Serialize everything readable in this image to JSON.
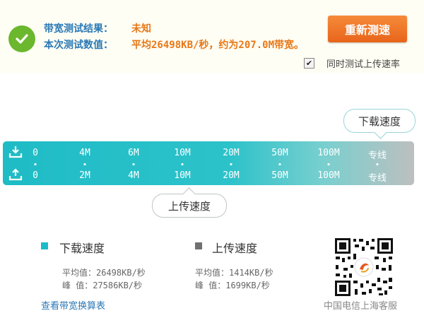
{
  "header": {
    "result_label": "带宽测试结果：",
    "result_value": "未知",
    "value_label": "本次测试数值：",
    "value_text": "平均26498KB/秒，约为207.0M带宽。",
    "retest_label": "重新测速",
    "upload_checkbox_checked": true,
    "upload_checkbox_label": "同时测试上传速率"
  },
  "callouts": {
    "download": "下载速度",
    "upload": "上传速度"
  },
  "speed_bar": {
    "download_ticks": [
      "0",
      "4M",
      "6M",
      "10M",
      "20M",
      "50M",
      "100M",
      "专线"
    ],
    "upload_ticks": [
      "0",
      "2M",
      "4M",
      "10M",
      "20M",
      "50M",
      "100M",
      "专线"
    ]
  },
  "legend": {
    "download": {
      "title": "下载速度",
      "color": "#1bbcc9",
      "avg": "平均值：26498KB/秒",
      "peak": "峰  值：27586KB/秒"
    },
    "upload": {
      "title": "上传速度",
      "color": "#707070",
      "avg": "平均值：1414KB/秒",
      "peak": "峰  值：1699KB/秒"
    }
  },
  "footer": {
    "bandwidth_link": "查看带宽换算表",
    "org_label": "中国电信上海客服"
  }
}
